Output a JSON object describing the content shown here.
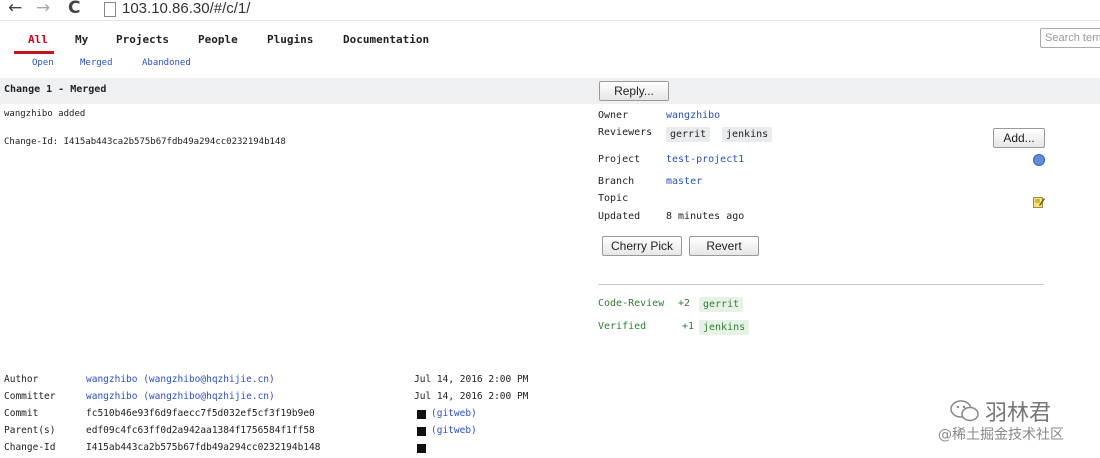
{
  "browser": {
    "back": "←",
    "forward": "→",
    "reload": "C",
    "url": "103.10.86.30/#/c/1/"
  },
  "menu": {
    "top": [
      "All",
      "My",
      "Projects",
      "People",
      "Plugins",
      "Documentation"
    ],
    "sub": [
      "Open",
      "Merged",
      "Abandoned"
    ],
    "search_placeholder": "Search term"
  },
  "change": {
    "title": "Change 1 - Merged",
    "reply_label": "Reply...",
    "message": "wangzhibo added",
    "change_id_line": "Change-Id: I415ab443ca2b575b67fdb49a294cc0232194b148"
  },
  "details": {
    "owner_label": "Owner",
    "owner": "wangzhibo",
    "reviewers_label": "Reviewers",
    "reviewers": [
      "gerrit",
      "jenkins"
    ],
    "add_label": "Add...",
    "project_label": "Project",
    "project": "test-project1",
    "branch_label": "Branch",
    "branch": "master",
    "topic_label": "Topic",
    "updated_label": "Updated",
    "updated": "8 minutes ago",
    "cherry_pick_label": "Cherry Pick",
    "revert_label": "Revert"
  },
  "labels": [
    {
      "name": "Code-Review",
      "score": "+2",
      "user": "gerrit"
    },
    {
      "name": "Verified",
      "score": "+1",
      "user": "jenkins"
    }
  ],
  "commit_info": {
    "author_label": "Author",
    "author": "wangzhibo (wangzhibo@hqzhijie.cn)",
    "author_date": "Jul 14, 2016 2:00 PM",
    "committer_label": "Committer",
    "committer": "wangzhibo (wangzhibo@hqzhijie.cn)",
    "committer_date": "Jul 14, 2016 2:00 PM",
    "commit_label": "Commit",
    "commit": "fc510b46e93f6d9faecc7f5d032ef5cf3f19b9e0",
    "commit_link": "(gitweb)",
    "parents_label": "Parent(s)",
    "parent": "edf09c4fc63ff0d2a942aa1384f1756584f1ff58",
    "parent_link": "(gitweb)",
    "changeid_label": "Change-Id",
    "changeid": "I415ab443ca2b575b67fdb49a294cc0232194b148"
  },
  "watermark": {
    "name": "羽林君",
    "site": "@稀土掘金技术社区"
  },
  "colors": {
    "active": "#d0021b",
    "link": "#2a52be",
    "green": "#2e7d32",
    "header_bg": "#eef0f2"
  },
  "icons": {
    "project_status": "blue-circle-icon",
    "topic_edit": "edit-pencil-icon",
    "copy": "copy-icon",
    "wechat": "wechat-icon"
  }
}
